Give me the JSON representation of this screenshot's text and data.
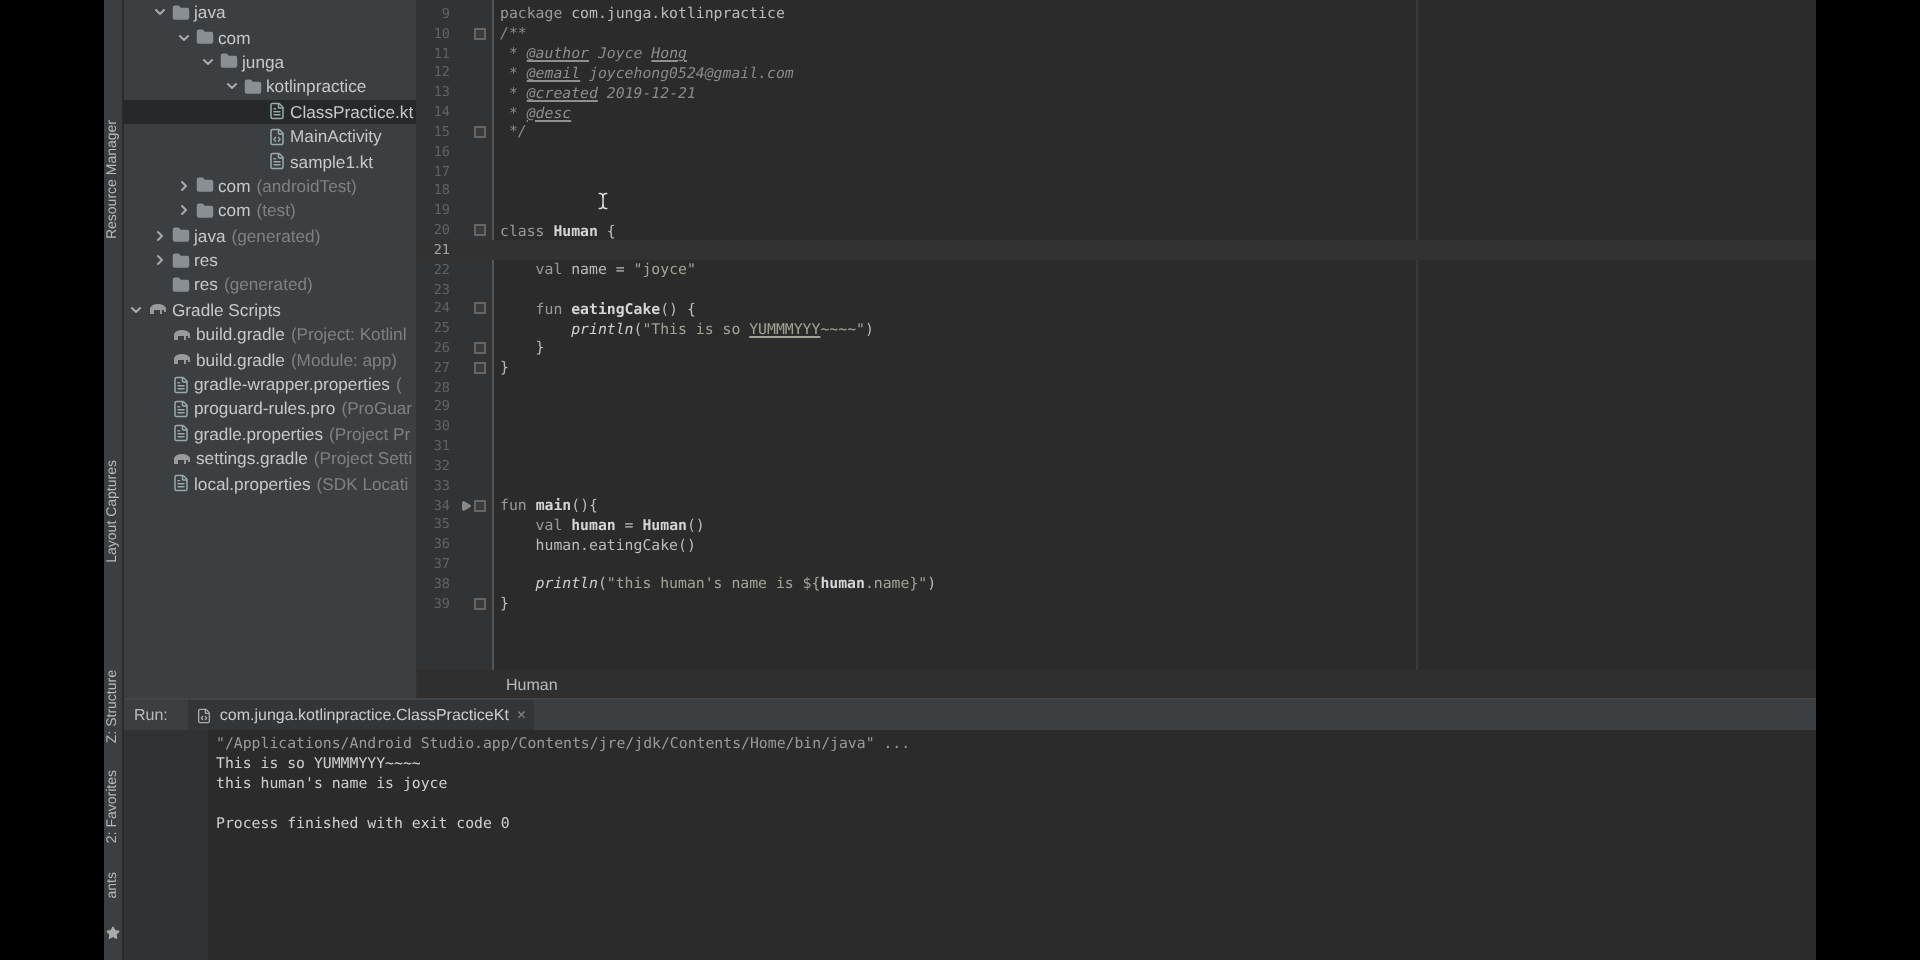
{
  "tool_strip": {
    "top_labels": [
      "Resource Manager",
      "Layout Captures"
    ],
    "bottom_labels": [
      "Z: Structure",
      "2: Favorites",
      "ants"
    ]
  },
  "project": {
    "source_tree": [
      {
        "name": "java",
        "kind": "folder",
        "expanded": true,
        "selected": false,
        "children": [
          {
            "name": "com",
            "kind": "package",
            "expanded": true,
            "selected": false,
            "children": [
              {
                "name": "junga",
                "kind": "package",
                "expanded": true,
                "selected": false,
                "children": [
                  {
                    "name": "kotlinpractice",
                    "kind": "package",
                    "expanded": true,
                    "selected": false,
                    "children": [
                      {
                        "name": "ClassPractice.kt",
                        "kind": "file",
                        "selected": true
                      },
                      {
                        "name": "MainActivity",
                        "kind": "class",
                        "selected": false
                      },
                      {
                        "name": "sample1.kt",
                        "kind": "file",
                        "selected": false
                      }
                    ]
                  }
                ]
              }
            ]
          },
          {
            "name": "com",
            "note": "(androidTest)",
            "kind": "package",
            "expanded": false,
            "selected": false
          },
          {
            "name": "com",
            "note": "(test)",
            "kind": "package",
            "expanded": false,
            "selected": false
          }
        ]
      },
      {
        "name": "java",
        "note": "(generated)",
        "kind": "folder",
        "expanded": false,
        "selected": false
      },
      {
        "name": "res",
        "kind": "folder",
        "expanded": false,
        "selected": false
      },
      {
        "name": "res",
        "note": "(generated)",
        "kind": "folder",
        "selected": false
      }
    ],
    "scripts": {
      "name": "Gradle Scripts",
      "kind": "gradle",
      "expanded": true,
      "selected": false,
      "children": [
        {
          "name": "build.gradle",
          "note": "(Project: Kotlinl",
          "kind": "gradle",
          "selected": false
        },
        {
          "name": "build.gradle",
          "note": "(Module: app)",
          "kind": "gradle",
          "selected": false
        },
        {
          "name": "gradle-wrapper.properties",
          "note": "(",
          "kind": "file",
          "selected": false
        },
        {
          "name": "proguard-rules.pro",
          "note": "(ProGuar",
          "kind": "file",
          "selected": false
        },
        {
          "name": "gradle.properties",
          "note": "(Project Pr",
          "kind": "file",
          "selected": false
        },
        {
          "name": "settings.gradle",
          "note": "(Project Setti",
          "kind": "gradle",
          "selected": false
        },
        {
          "name": "local.properties",
          "note": "(SDK Locati",
          "kind": "file",
          "selected": false
        }
      ]
    }
  },
  "editor": {
    "lines": [
      {
        "number": "9",
        "tokens": [
          {
            "text": "package ",
            "kind": "keyword"
          },
          {
            "text": "com.junga.kotlinpractice",
            "kind": "plain"
          }
        ]
      },
      {
        "number": "10",
        "fold": true,
        "tokens": [
          {
            "text": "/**",
            "kind": "comment"
          }
        ]
      },
      {
        "number": "11",
        "tokens": [
          {
            "text": " * ",
            "kind": "comment"
          },
          {
            "text": "@author",
            "kind": "doc-tag"
          },
          {
            "text": " Joyce ",
            "kind": "comment"
          },
          {
            "text": "Hong",
            "kind": "doc-tag"
          }
        ]
      },
      {
        "number": "12",
        "tokens": [
          {
            "text": " * ",
            "kind": "comment"
          },
          {
            "text": "@email",
            "kind": "doc-tag"
          },
          {
            "text": " joycehong0524@gmail.com",
            "kind": "comment"
          }
        ]
      },
      {
        "number": "13",
        "tokens": [
          {
            "text": " * ",
            "kind": "comment"
          },
          {
            "text": "@created",
            "kind": "doc-tag"
          },
          {
            "text": " 2019-12-21",
            "kind": "comment"
          }
        ]
      },
      {
        "number": "14",
        "tokens": [
          {
            "text": " * ",
            "kind": "comment"
          },
          {
            "text": "@desc",
            "kind": "doc-tag"
          }
        ]
      },
      {
        "number": "15",
        "fold": true,
        "tokens": [
          {
            "text": " */",
            "kind": "comment"
          }
        ]
      },
      {
        "number": "16"
      },
      {
        "number": "17"
      },
      {
        "number": "18"
      },
      {
        "number": "19"
      },
      {
        "number": "20",
        "fold": true,
        "tokens": [
          {
            "text": "class ",
            "kind": "keyword"
          },
          {
            "text": "Human",
            "kind": "bold"
          },
          {
            "text": " {",
            "kind": "plain"
          }
        ]
      },
      {
        "number": "21",
        "current": true
      },
      {
        "number": "22",
        "tokens": [
          {
            "text": "    val ",
            "kind": "keyword"
          },
          {
            "text": "name",
            "kind": "plain"
          },
          {
            "text": " = ",
            "kind": "plain"
          },
          {
            "text": "\"joyce\"",
            "kind": "string"
          }
        ]
      },
      {
        "number": "23"
      },
      {
        "number": "24",
        "fold": true,
        "tokens": [
          {
            "text": "    fun ",
            "kind": "keyword"
          },
          {
            "text": "eatingCake",
            "kind": "bold"
          },
          {
            "text": "() {",
            "kind": "plain"
          }
        ]
      },
      {
        "number": "25",
        "tokens": [
          {
            "text": "        println",
            "kind": "italic"
          },
          {
            "text": "(",
            "kind": "plain"
          },
          {
            "text": "\"This is so ",
            "kind": "string"
          },
          {
            "text": "YUMMMYYY",
            "kind": "string-underline"
          },
          {
            "text": "~~~~\"",
            "kind": "string"
          },
          {
            "text": ")",
            "kind": "plain"
          }
        ]
      },
      {
        "number": "26",
        "fold": true,
        "tokens": [
          {
            "text": "    }",
            "kind": "plain"
          }
        ]
      },
      {
        "number": "27",
        "fold": true,
        "tokens": [
          {
            "text": "}",
            "kind": "plain"
          }
        ]
      },
      {
        "number": "28"
      },
      {
        "number": "29"
      },
      {
        "number": "30"
      },
      {
        "number": "31"
      },
      {
        "number": "32"
      },
      {
        "number": "33"
      },
      {
        "number": "34",
        "fold": true,
        "run": true,
        "tokens": [
          {
            "text": "fun ",
            "kind": "keyword"
          },
          {
            "text": "main",
            "kind": "bold"
          },
          {
            "text": "(){",
            "kind": "plain"
          }
        ]
      },
      {
        "number": "35",
        "tokens": [
          {
            "text": "    val ",
            "kind": "keyword"
          },
          {
            "text": "human",
            "kind": "bold"
          },
          {
            "text": " = ",
            "kind": "plain"
          },
          {
            "text": "Human",
            "kind": "bold"
          },
          {
            "text": "()",
            "kind": "plain"
          }
        ]
      },
      {
        "number": "36",
        "tokens": [
          {
            "text": "    human.eatingCake()",
            "kind": "plain"
          }
        ]
      },
      {
        "number": "37"
      },
      {
        "number": "38",
        "tokens": [
          {
            "text": "    println",
            "kind": "italic"
          },
          {
            "text": "(",
            "kind": "plain"
          },
          {
            "text": "\"this human's name is ${",
            "kind": "string"
          },
          {
            "text": "human",
            "kind": "bold"
          },
          {
            "text": ".name",
            "kind": "string"
          },
          {
            "text": "}\"",
            "kind": "string"
          },
          {
            "text": ")",
            "kind": "plain"
          }
        ]
      },
      {
        "number": "39",
        "fold": true,
        "tokens": [
          {
            "text": "}",
            "kind": "plain"
          }
        ]
      }
    ],
    "breadcrumb": "Human"
  },
  "run": {
    "label": "Run:",
    "tab": "com.junga.kotlinpractice.ClassPracticeKt",
    "tab_close": "×",
    "console": [
      {
        "text": "\"/Applications/Android Studio.app/Contents/jre/jdk/Contents/Home/bin/java\" ...",
        "kind": "command"
      },
      {
        "text": "This is so YUMMMYYY~~~~",
        "kind": "output"
      },
      {
        "text": "this human's name is joyce",
        "kind": "output"
      },
      {
        "kind": "blank"
      },
      {
        "text": "Process finished with exit code 0",
        "kind": "output"
      }
    ]
  }
}
